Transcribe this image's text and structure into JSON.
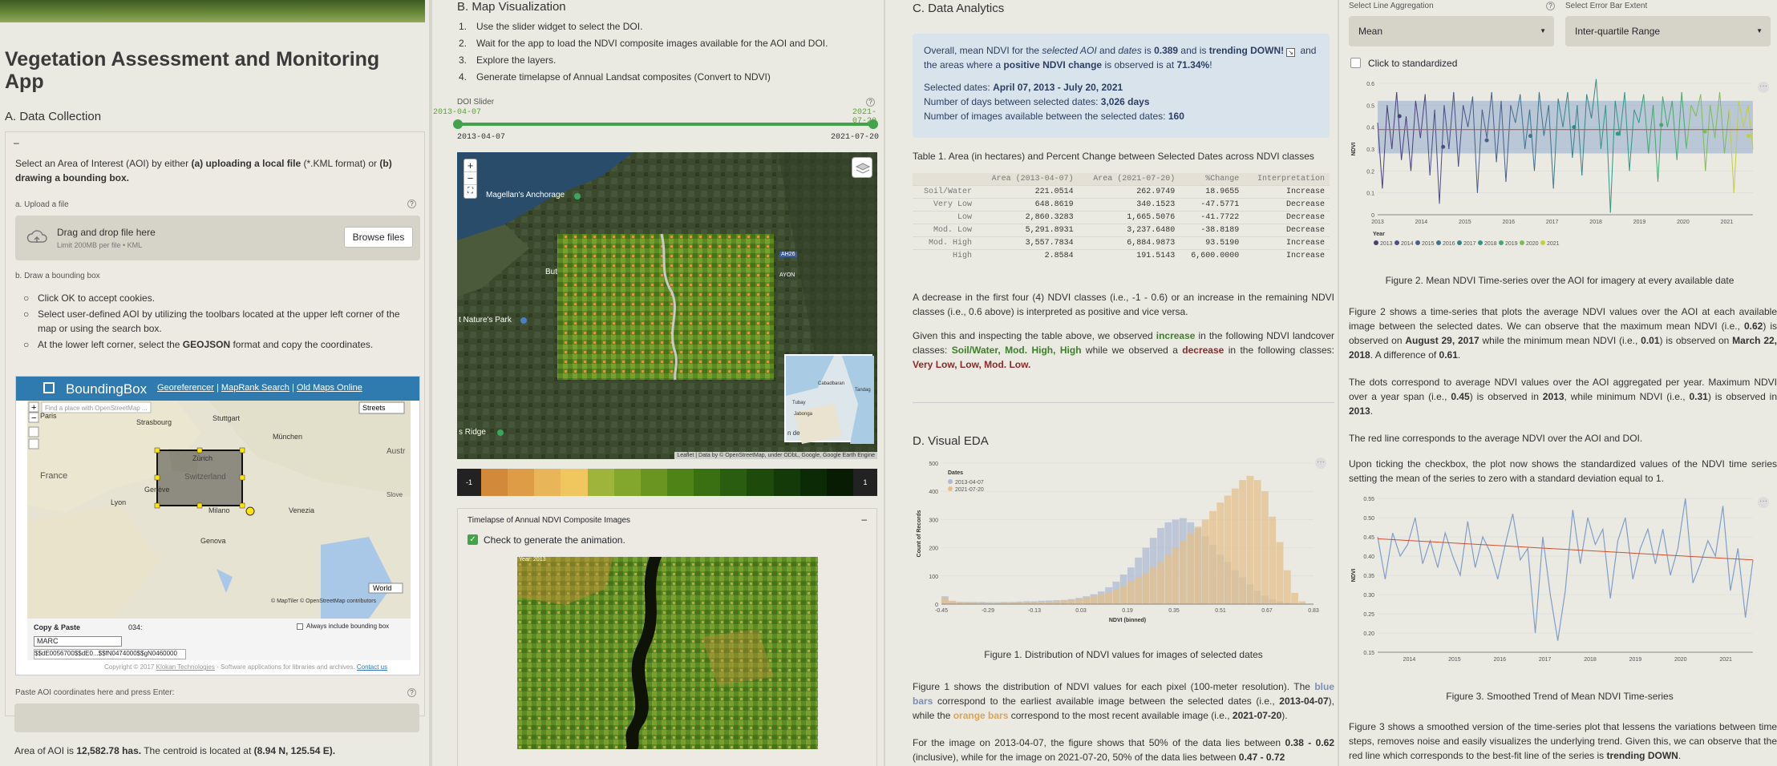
{
  "app": {
    "title": "Vegetation Assessment and Monitoring App"
  },
  "colors": {
    "ndvi": [
      "#d2893a",
      "#dd9c45",
      "#e9b559",
      "#f0c75e",
      "#9fb43a",
      "#83a62c",
      "#6a9520",
      "#4f8318",
      "#3a6f12",
      "#2b5d10",
      "#1e4a0c",
      "#143a09",
      "#0d2a06",
      "#081c04"
    ]
  },
  "a": {
    "heading": "A. Data Collection",
    "collapse": "–",
    "intro_1": "Select an Area of Interest (AOI) by either ",
    "intro_2": "(a) uploading a local file",
    "intro_3": " (*.KML format) or ",
    "intro_4": "(b) drawing a bounding box.",
    "upload_label": "a. Upload a file",
    "help": "?",
    "drop_title": "Drag and drop file here",
    "drop_limit": "Limit 200MB per file • KML",
    "browse": "Browse files",
    "draw_label": "b. Draw a bounding box",
    "bullets": [
      "Click OK to accept cookies.",
      "Select user-defined AOI by utilizing the toolbars located at the upper left corner of the map or using the search box."
    ],
    "bullet3_a": "At the lower left corner, select the ",
    "bullet3_b": "GEOJSON",
    "bullet3_c": " format and copy the coordinates.",
    "bbox": {
      "brand": "BoundingBox",
      "links": [
        "Georeferencer",
        "MapRank Search",
        "Old Maps Online"
      ],
      "sep": "|",
      "search_ph": "Find a place with OpenStreetMap ...",
      "layer": "Streets",
      "world": "World",
      "attrib": "© MapTiler © OpenStreetMap contributors",
      "copy_paste": "Copy & Paste",
      "coord_prefix": "034:",
      "always": "Always include bounding box",
      "format": "MARC",
      "coords": "$$dE0056700$$dE0...$$fN0474000$$gN0460000",
      "footer_1": "Copyright © 2017",
      "footer_2": "Klokan Technologies",
      "footer_3": " - Software applications for libraries and archives.",
      "contact": "Contact us"
    },
    "map_labels": [
      "Paris",
      "Strasbourg",
      "Stuttgart",
      "München",
      "Zürich",
      "Switzerland",
      "France",
      "Lyon",
      "Genève",
      "Milano",
      "Venezia",
      "Genova",
      "Austr",
      "Slove"
    ],
    "paste_label": "Paste AOI coordinates here and press Enter:",
    "area_1": "Area of AOI is ",
    "area_2": "12,582.78 has.",
    "area_3": " The centroid is located at ",
    "area_4": "(8.94 N, 125.54 E)."
  },
  "b": {
    "heading": "B. Map Visualization",
    "steps": [
      "Use the slider widget to select the DOI.",
      "Wait for the app to load the NDVI composite images available for the AOI and DOI.",
      "Explore the layers.",
      "Generate timelapse of Annual Landsat composites (Convert to NDVI)"
    ],
    "nums": [
      "1.",
      "2.",
      "3.",
      "4."
    ],
    "slider_label": "DOI Slider",
    "slider_start": "2013-04-07",
    "slider_end": "2021-07-20",
    "slider_min": "2013-04-07",
    "slider_max": "2021-07-20",
    "map_labels": {
      "anchorage": "Magellan's Anchorage",
      "but": "But",
      "park": "t Nature's Park",
      "ridge": "s Ridge",
      "road": "AH26",
      "ayon": "AYON",
      "mini": [
        "Cabadbaran",
        "Tubay",
        "Jabonga",
        "Tandag"
      ],
      "mini_de": "n de"
    },
    "attrib": "Leaflet | Data by © OpenStreetMap, under ODbL, Google, Google Earth Engine",
    "zoom_in": "+",
    "zoom_out": "−",
    "colorbar_min": "-1",
    "colorbar_max": "1",
    "timelapse_title": "Timelapse of Annual NDVI Composite Images",
    "timelapse_collapse": "–",
    "timelapse_check": "Check to generate the animation.",
    "year_tag": "Year: 2013"
  },
  "c": {
    "heading": "C. Data Analytics",
    "info_1": "Overall, mean NDVI for the ",
    "info_2": "selected AOI",
    "info_3": " and ",
    "info_4": "dates",
    "info_5": " is ",
    "info_6": "0.389",
    "info_7": " and is ",
    "info_8": "trending DOWN!",
    "info_9": " and the areas where a ",
    "info_10": "positive NDVI change",
    "info_11": " is observed is at ",
    "info_12": "71.34%",
    "info_13": "!",
    "sel_1": "Selected dates: ",
    "sel_2": "April 07, 2013 - July 20, 2021",
    "days_1": "Number of days between selected dates: ",
    "days_2": "3,026 days",
    "imgs_1": "Number of images available between the selected dates: ",
    "imgs_2": "160",
    "table_caption": "Table 1. Area (in hectares) and Percent Change between Selected Dates across NDVI classes",
    "table_headers": [
      "",
      "Area (2013-04-07)",
      "Area (2021-07-20)",
      "%Change",
      "Interpretation"
    ],
    "table_rows": [
      [
        "Soil/Water",
        "221.0514",
        "262.9749",
        "18.9655",
        "Increase"
      ],
      [
        "Very Low",
        "648.8619",
        "340.1523",
        "-47.5771",
        "Decrease"
      ],
      [
        "Low",
        "2,860.3283",
        "1,665.5076",
        "-41.7722",
        "Decrease"
      ],
      [
        "Mod. Low",
        "5,291.8931",
        "3,237.6480",
        "-38.8189",
        "Decrease"
      ],
      [
        "Mod. High",
        "3,557.7834",
        "6,884.9873",
        "93.5190",
        "Increase"
      ],
      [
        "High",
        "2.8584",
        "191.5143",
        "6,600.0000",
        "Increase"
      ]
    ],
    "para1": "A decrease in the first four (4) NDVI classes (i.e., -1 - 0.6) or an increase in the remaining NDVI classes (i.e., 0.6 above) is interpreted as positive and vice versa.",
    "para2_1": "Given this and inspecting the table above, we observed ",
    "para2_2": "increase",
    "para2_3": " in the following NDVI landcover classes: ",
    "para2_4": "Soil/Water, Mod. High, High",
    "para2_5": " while we observed a ",
    "para2_6": "decrease",
    "para2_7": " in the following classes: ",
    "para2_8": "Very Low, Low, Mod. Low.",
    "eda_heading": "D. Visual EDA",
    "fig1_caption": "Figure 1. Distribution of NDVI values for images of selected dates",
    "fig1_p_1": "Figure 1 shows the distribution of NDVI values for each pixel (100-meter resolution). The ",
    "fig1_p_2": "blue bars",
    "fig1_p_3": " correspond to the earliest available image between the selected dates (i.e., ",
    "fig1_p_4": "2013-04-07",
    "fig1_p_5": "), while the ",
    "fig1_p_6": "orange bars",
    "fig1_p_7": " correspond to the most recent available image (i.e., ",
    "fig1_p_8": "2021-07-20",
    "fig1_p_9": ").",
    "fig1_p2_1": "For the image on 2013-04-07, the figure shows that 50% of the data lies between ",
    "fig1_p2_2": "0.38 - 0.62",
    "fig1_p2_3": " (inclusive), while for the image on 2021-07-20, 50% of the data lies between ",
    "fig1_p2_4": "0.47 - 0.72"
  },
  "d": {
    "agg_label": "Select Line Aggregation",
    "agg_value": "Mean",
    "err_label": "Select Error Bar Extent",
    "err_value": "Inter-quartile Range",
    "help": "?",
    "std_label": "Click to standardized",
    "fig2_caption": "Figure 2. Mean NDVI Time-series over the AOI for imagery at every available date",
    "fig2_p1_1": "Figure 2 shows a time-series that plots the average NDVI values over the AOI at each available image between the selected dates. We can observe that the maximum mean NDVI (i.e., ",
    "fig2_p1_2": "0.62",
    "fig2_p1_3": ") is observed on ",
    "fig2_p1_4": "August 29, 2017",
    "fig2_p1_5": " while the minimum mean NDVI (i.e., ",
    "fig2_p1_6": "0.01",
    "fig2_p1_7": ") is observed on ",
    "fig2_p1_8": "March 22, 2018",
    "fig2_p1_9": ". A difference of ",
    "fig2_p1_10": "0.61",
    "fig2_p1_11": ".",
    "fig2_p2_1": "The dots correspond to average NDVI values over the AOI aggregated per year. Maximum NDVI over a year span (i.e., ",
    "fig2_p2_2": "0.45",
    "fig2_p2_3": ") is observed in ",
    "fig2_p2_4": "2013",
    "fig2_p2_5": ", while minimum NDVI (i.e., ",
    "fig2_p2_6": "0.31",
    "fig2_p2_7": ") is observed in ",
    "fig2_p2_8": "2013",
    "fig2_p2_9": ".",
    "fig2_p3": "The red line corresponds to the average NDVI over the AOI and DOI.",
    "fig2_p4": "Upon ticking the checkbox, the plot now shows the standardized values of the NDVI time series setting the mean of the series to zero with a standard deviation equal to 1.",
    "fig3_caption": "Figure 3. Smoothed Trend of Mean NDVI Time-series",
    "fig3_p_1": "Figure 3 shows a smoothed version of the time-series plot that lessens the variations between time steps, removes noise and easily visualizes the underlying trend. Given this, we can observe that the red line which corresponds to the best-fit line of the series is ",
    "fig3_p_2": "trending DOWN",
    "fig3_p_3": ".",
    "menu": "···"
  },
  "chart_data": [
    {
      "type": "bar",
      "title": "",
      "xlabel": "NDVI (binned)",
      "ylabel": "Count of Records",
      "legend_title": "Dates",
      "legend_position": "top-left",
      "ylim": [
        0,
        500
      ],
      "yticks": [
        0,
        100,
        200,
        300,
        400,
        500
      ],
      "xticks": [
        "-0.45",
        "-0.29",
        "-0.13",
        "0.03",
        "0.19",
        "0.35",
        "0.51",
        "0.67",
        "0.83"
      ],
      "series": [
        {
          "name": "2013-04-07",
          "color": "#aebbd4",
          "values": [
            28,
            10,
            8,
            8,
            8,
            8,
            7,
            7,
            8,
            8,
            9,
            10,
            10,
            12,
            13,
            14,
            15,
            18,
            22,
            28,
            35,
            45,
            60,
            80,
            105,
            130,
            165,
            200,
            235,
            270,
            290,
            300,
            305,
            290,
            270,
            240,
            210,
            175,
            150,
            120,
            95,
            70,
            48,
            30,
            18,
            10,
            5,
            2,
            1,
            0
          ]
        },
        {
          "name": "2021-07-20",
          "color": "#e4c08c",
          "values": [
            22,
            12,
            8,
            6,
            5,
            4,
            4,
            4,
            5,
            5,
            6,
            6,
            7,
            8,
            9,
            10,
            12,
            15,
            18,
            22,
            28,
            34,
            42,
            52,
            65,
            80,
            95,
            110,
            130,
            150,
            175,
            200,
            225,
            250,
            275,
            300,
            330,
            360,
            385,
            410,
            440,
            455,
            440,
            400,
            310,
            220,
            120,
            40,
            10,
            2
          ]
        }
      ]
    },
    {
      "type": "line",
      "title": "",
      "xlabel": "",
      "ylabel": "NDVI",
      "legend_title": "Year",
      "legend_position": "bottom",
      "ylim": [
        0,
        0.6
      ],
      "yticks": [
        0,
        0.1,
        0.2,
        0.3,
        0.4,
        0.5,
        0.6
      ],
      "xlim": [
        2013,
        2021.6
      ],
      "xticks": [
        "2013",
        "2014",
        "2015",
        "2016",
        "2017",
        "2018",
        "2019",
        "2020",
        "2021"
      ],
      "mean_line": 0.389,
      "band": [
        0.28,
        0.52
      ],
      "years": [
        "2013",
        "2014",
        "2015",
        "2016",
        "2017",
        "2018",
        "2019",
        "2020",
        "2021"
      ],
      "year_colors": [
        "#4a3f7a",
        "#4a4f86",
        "#47618c",
        "#3f728c",
        "#37838a",
        "#2f9785",
        "#45a870",
        "#7dbd56",
        "#c2cf3e"
      ],
      "yearly_dots": [
        0.45,
        0.31,
        0.34,
        0.36,
        0.4,
        0.37,
        0.41,
        0.38,
        0.36
      ],
      "values": [
        0.42,
        0.12,
        0.5,
        0.3,
        0.56,
        0.25,
        0.45,
        0.2,
        0.52,
        0.35,
        0.55,
        0.18,
        0.48,
        0.05,
        0.5,
        0.3,
        0.56,
        0.22,
        0.5,
        0.4,
        0.54,
        0.1,
        0.48,
        0.35,
        0.56,
        0.24,
        0.52,
        0.15,
        0.5,
        0.42,
        0.55,
        0.3,
        0.48,
        0.2,
        0.56,
        0.36,
        0.5,
        0.12,
        0.53,
        0.4,
        0.56,
        0.26,
        0.5,
        0.18,
        0.55,
        0.44,
        0.62,
        0.3,
        0.5,
        0.01,
        0.52,
        0.36,
        0.56,
        0.2,
        0.48,
        0.42,
        0.55,
        0.28,
        0.5,
        0.15,
        0.54,
        0.4,
        0.52,
        0.25,
        0.56,
        0.3,
        0.5,
        0.45,
        0.55,
        0.2,
        0.5,
        0.35,
        0.56,
        0.28,
        0.48,
        0.1,
        0.52,
        0.4,
        0.5,
        0.3
      ]
    },
    {
      "type": "line",
      "title": "",
      "xlabel": "",
      "ylabel": "NDVI",
      "ylim": [
        0.15,
        0.55
      ],
      "yticks": [
        0.15,
        0.2,
        0.25,
        0.3,
        0.35,
        0.4,
        0.45,
        0.5,
        0.55
      ],
      "xlim": [
        2013.3,
        2021.6
      ],
      "xticks": [
        "2014",
        "2015",
        "2016",
        "2017",
        "2018",
        "2019",
        "2020",
        "2021"
      ],
      "trend": [
        0.445,
        0.39
      ],
      "values": [
        0.45,
        0.34,
        0.46,
        0.4,
        0.43,
        0.5,
        0.38,
        0.44,
        0.37,
        0.46,
        0.4,
        0.35,
        0.49,
        0.37,
        0.45,
        0.41,
        0.34,
        0.43,
        0.51,
        0.39,
        0.42,
        0.2,
        0.45,
        0.3,
        0.18,
        0.31,
        0.52,
        0.38,
        0.5,
        0.43,
        0.47,
        0.29,
        0.44,
        0.5,
        0.34,
        0.42,
        0.47,
        0.38,
        0.47,
        0.35,
        0.42,
        0.55,
        0.33,
        0.38,
        0.44,
        0.4,
        0.53,
        0.31,
        0.42,
        0.24,
        0.39
      ]
    }
  ]
}
